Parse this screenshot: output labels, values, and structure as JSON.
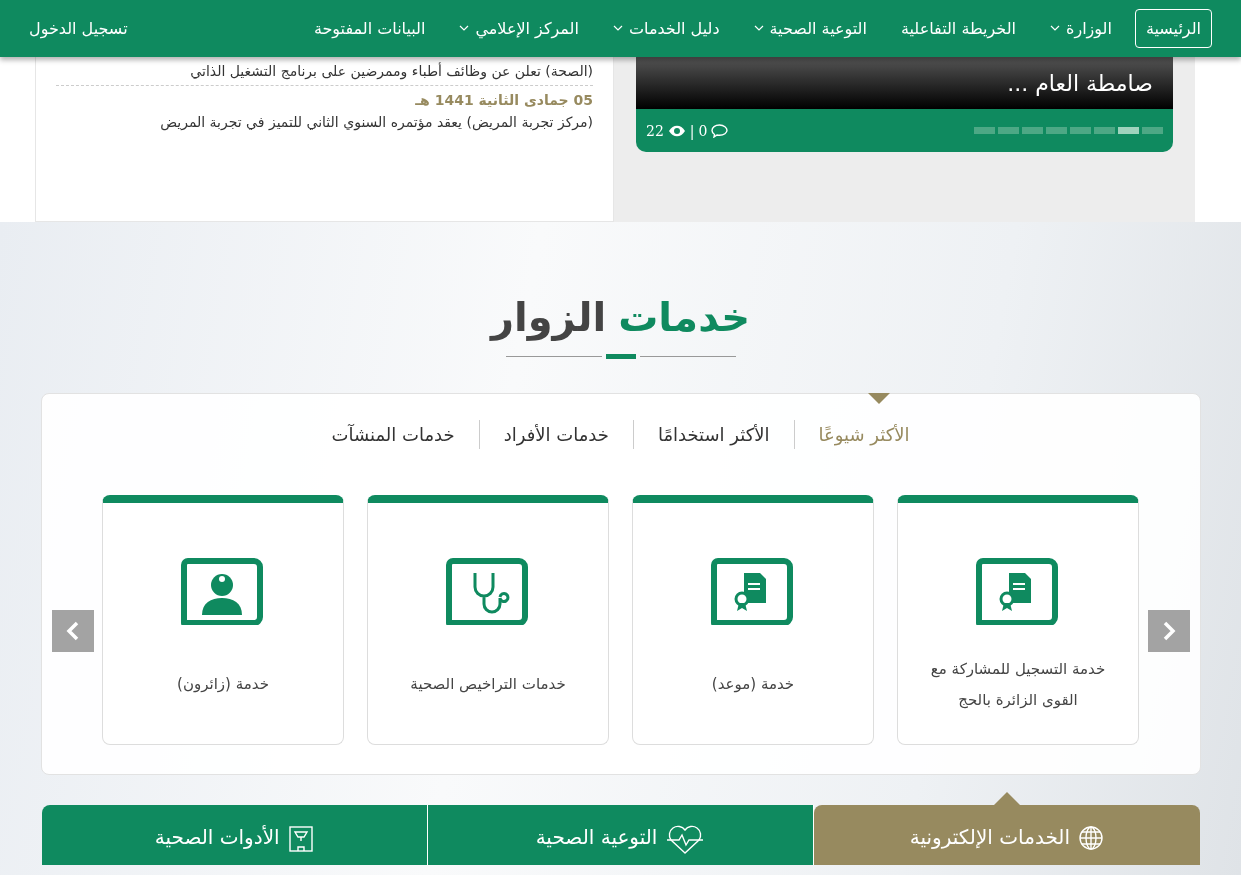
{
  "nav": {
    "items": [
      {
        "label": "الرئيسية",
        "selected": true,
        "dropdown": false
      },
      {
        "label": "الوزارة",
        "selected": false,
        "dropdown": true
      },
      {
        "label": "الخريطة التفاعلية",
        "selected": false,
        "dropdown": false
      },
      {
        "label": "التوعية الصحية",
        "selected": false,
        "dropdown": true
      },
      {
        "label": "دليل الخدمات",
        "selected": false,
        "dropdown": true
      },
      {
        "label": "المركز الإعلامي",
        "selected": false,
        "dropdown": true
      },
      {
        "label": "البيانات المفتوحة",
        "selected": false,
        "dropdown": false
      }
    ],
    "login": "تسجيل الدخول"
  },
  "news": [
    {
      "title": "(الصحة) تعلن عن وظائف أطباء وممرضين على برنامج التشغيل الذاتي"
    },
    {
      "day": "05",
      "month": "جمادى الثانية",
      "year": "1441",
      "suffix": "هـ",
      "title": "(مركز تجربة المريض) يعقد مؤتمره السنوي الثاني للتميز في تجربة المريض"
    }
  ],
  "slider": {
    "caption": "صامطة العام ...",
    "views": "22",
    "separator": "|",
    "comments": "0",
    "dots": [
      {
        "selected": false
      },
      {
        "selected": true
      },
      {
        "selected": false
      },
      {
        "selected": false
      },
      {
        "selected": false
      },
      {
        "selected": false
      },
      {
        "selected": false
      },
      {
        "selected": false
      }
    ]
  },
  "visitor_services": {
    "title_accent": "خدمات",
    "title_rest": "الزوار",
    "tabs": [
      {
        "label": "الأكثر شيوعًا",
        "selected": true
      },
      {
        "label": "الأكثر استخدامًا",
        "selected": false
      },
      {
        "label": "خدمات الأفراد",
        "selected": false
      },
      {
        "label": "خدمات المنشآت",
        "selected": false
      }
    ],
    "cards": [
      {
        "kind": "document",
        "label": "خدمة التسجيل للمشاركة مع القوى الزائرة بالحج"
      },
      {
        "kind": "document",
        "label": "خدمة (موعد)"
      },
      {
        "kind": "stethoscope",
        "label": "خدمات التراخيص الصحية"
      },
      {
        "kind": "doctor",
        "label": "خدمة (زائرون)"
      }
    ]
  },
  "bottom_tabs": [
    {
      "kind": "globe",
      "label": "الخدمات الإلكترونية",
      "selected": true
    },
    {
      "kind": "heart",
      "label": "التوعية الصحية",
      "selected": false
    },
    {
      "kind": "scale",
      "label": "الأدوات الصحية",
      "selected": false
    }
  ]
}
